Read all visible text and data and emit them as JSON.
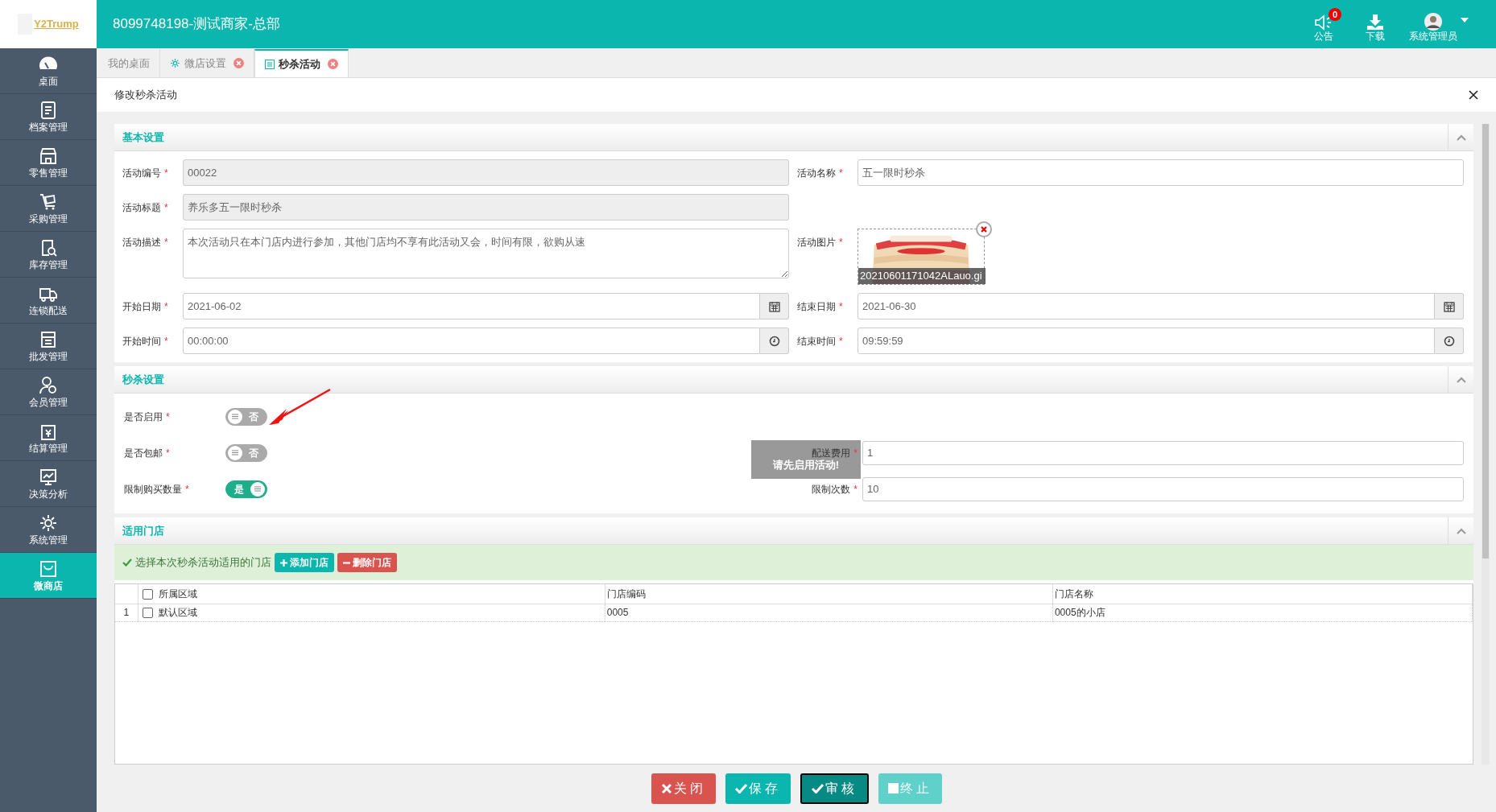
{
  "header": {
    "logo": "Y2Trump",
    "title": "8099748198-测试商家-总部",
    "notice": {
      "label": "公告",
      "badge": "0"
    },
    "download": {
      "label": "下载"
    },
    "user": {
      "label": "系统管理员"
    }
  },
  "sidebar": {
    "items": [
      {
        "label": "桌面",
        "selected": false
      },
      {
        "label": "档案管理",
        "selected": false
      },
      {
        "label": "零售管理",
        "selected": false
      },
      {
        "label": "采购管理",
        "selected": false
      },
      {
        "label": "库存管理",
        "selected": false
      },
      {
        "label": "连锁配送",
        "selected": false
      },
      {
        "label": "批发管理",
        "selected": false
      },
      {
        "label": "会员管理",
        "selected": false
      },
      {
        "label": "结算管理",
        "selected": false
      },
      {
        "label": "决策分析",
        "selected": false
      },
      {
        "label": "系统管理",
        "selected": false
      },
      {
        "label": "微商店",
        "selected": true
      }
    ]
  },
  "tabs": [
    {
      "label": "我的桌面",
      "selected": false,
      "closable": false
    },
    {
      "label": "微店设置",
      "selected": false,
      "closable": true
    },
    {
      "label": "秒杀活动",
      "selected": true,
      "closable": true
    }
  ],
  "page": {
    "title": "修改秒杀活动"
  },
  "basic": {
    "title": "基本设置",
    "rows": [
      {
        "left": {
          "label": "活动编号",
          "mark": "*",
          "kind": "text",
          "value": "00022",
          "disabled": true
        },
        "right": {
          "label": "活动名称",
          "mark": "*",
          "kind": "text",
          "value": "五一限时秒杀",
          "disabled": false
        }
      },
      {
        "left": {
          "label": "活动标题",
          "mark": "*",
          "kind": "text",
          "value": "养乐多五一限时秒杀",
          "disabled": true
        }
      },
      {
        "left": {
          "label": "活动描述",
          "mark": "*",
          "kind": "textarea",
          "value": "本次活动只在本门店内进行参加，其他门店均不享有此活动又会，时间有限，欲购从速",
          "disabled": false
        },
        "right": {
          "label": "活动图片",
          "mark": "*",
          "caption": "20210601171042ALauo.gi"
        }
      },
      {
        "left": {
          "label": "开始日期",
          "mark": "*",
          "kind": "date",
          "value": "2021-06-02",
          "disabled": false
        },
        "right": {
          "label": "结束日期",
          "mark": "*",
          "kind": "date",
          "value": "2021-06-30",
          "disabled": false
        }
      },
      {
        "left": {
          "label": "开始时间",
          "mark": "*",
          "kind": "time",
          "value": "00:00:00",
          "disabled": false
        },
        "right": {
          "label": "结束时间",
          "mark": "*",
          "kind": "time",
          "value": "09:59:59",
          "disabled": false
        }
      }
    ]
  },
  "flash": {
    "title": "秒杀设置",
    "tooltip": "请先启用活动!",
    "rows": [
      {
        "left": {
          "label": "是否启用",
          "mark": "*",
          "on": false,
          "text": "否"
        }
      },
      {
        "left": {
          "label": "是否包邮",
          "mark": "*",
          "on": false,
          "text": "否"
        },
        "right": {
          "label": "配送费用",
          "mark": "*",
          "value": "1"
        }
      },
      {
        "left": {
          "label": "限制购买数量",
          "mark": "*",
          "on": true,
          "text": "是"
        },
        "right": {
          "label": "限制次数",
          "mark": "*",
          "value": "10"
        }
      }
    ]
  },
  "stores": {
    "title": "适用门店",
    "hint": "选择本次秒杀活动适用的门店",
    "actions": [
      {
        "label": "添加门店",
        "kind": "add"
      },
      {
        "label": "删除门店",
        "kind": "delete"
      }
    ],
    "table": {
      "header_checked": false,
      "columns": [
        "所属区域",
        "门店编码",
        "门店名称"
      ],
      "rows": [
        {
          "index": "1",
          "checked": false,
          "cells": [
            "默认区域",
            "0005",
            "0005的小店"
          ]
        }
      ]
    }
  },
  "footer_buttons": [
    {
      "label": "关闭",
      "kind": "danger"
    },
    {
      "label": "保存",
      "kind": "primary"
    },
    {
      "label": "审核",
      "kind": "focused"
    },
    {
      "label": "终止",
      "kind": "disabled"
    }
  ]
}
